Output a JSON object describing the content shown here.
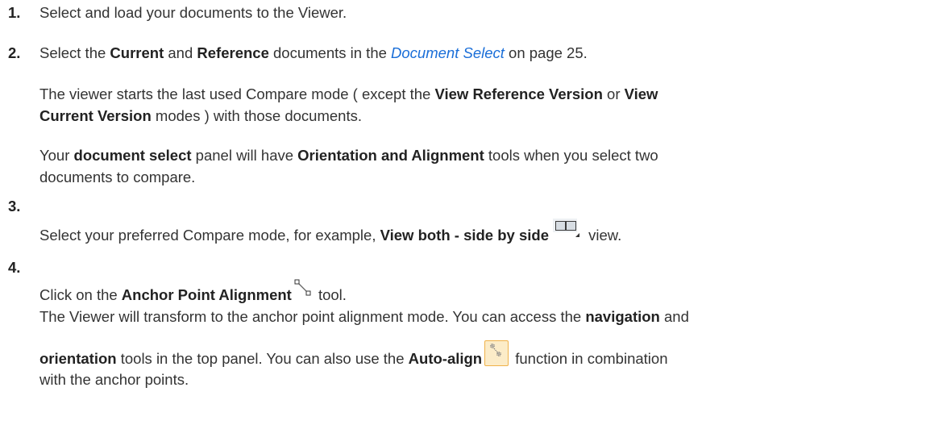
{
  "steps": [
    {
      "number": "1."
    },
    {
      "number": "2."
    },
    {
      "number": "3."
    },
    {
      "number": "4."
    }
  ],
  "step1": {
    "text": "Select and load your documents to the Viewer."
  },
  "step2": {
    "pre": "Select the ",
    "current": "Current",
    "and": " and ",
    "reference": "Reference",
    "docs_in": " documents in the ",
    "link": "Document Select",
    "page": " on page 25.",
    "para1_a": "The viewer starts the last used Compare mode ( except the ",
    "para1_view_ref": "View Reference Version",
    "para1_or": " or ",
    "para1_view": "View",
    "para1_b_bold": "Current Version",
    "para1_c": " modes ) with those documents.",
    "para2_a": "Your ",
    "para2_docsel": "document select",
    "para2_b": " panel will have ",
    "para2_orient": "Orientation and Alignment",
    "para2_c": " tools when you select two",
    "para2_d": "documents to compare."
  },
  "step3": {
    "pre": "Select your preferred Compare mode, for example, ",
    "bold": "View both - side by side",
    "post": " view.",
    "icon": "side-by-side-view-icon"
  },
  "step4": {
    "pre": "Click on the ",
    "bold": "Anchor Point Alignment",
    "post": " tool.",
    "icon": "anchor-point-icon",
    "l2_a": "The Viewer will transform to the anchor point alignment mode. You can access the ",
    "l2_nav": "navigation",
    "l2_b": " and",
    "l3_orient": "orientation",
    "l3_a": " tools in the top panel. You can also use the ",
    "l3_auto": "Auto-align",
    "l3_b": " function in combination",
    "l4": "with the anchor points.",
    "auto_icon": "auto-align-icon"
  },
  "colors": {
    "text": "#333333",
    "link": "#1a6ed8",
    "auto_icon_bg": "#fcecc8",
    "auto_icon_border": "#f0b24a"
  }
}
